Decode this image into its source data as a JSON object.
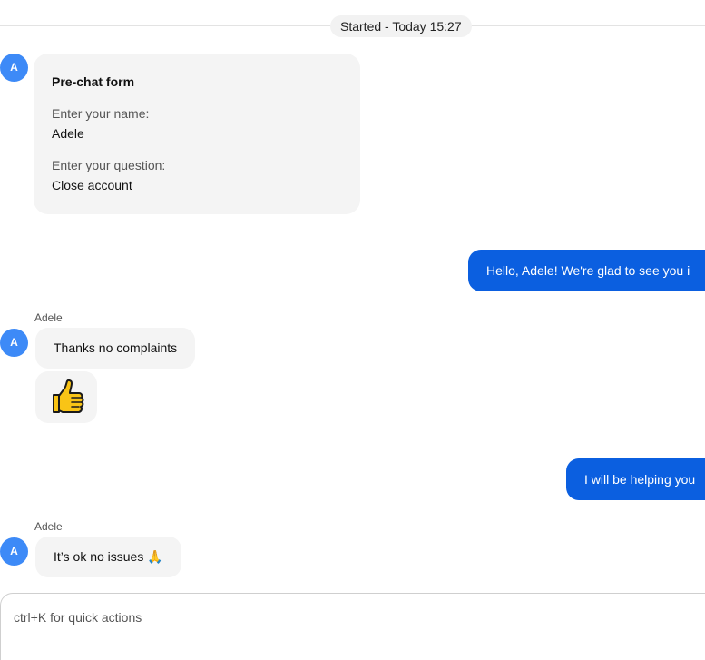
{
  "session": {
    "started_label": "Started - Today 15:27"
  },
  "avatar_initial": "A",
  "prechat_form": {
    "title": "Pre-chat form",
    "fields": [
      {
        "label": "Enter your name:",
        "value": "Adele"
      },
      {
        "label": "Enter your question:",
        "value": "Close account"
      }
    ]
  },
  "messages": [
    {
      "direction": "outgoing",
      "text": "Hello, Adele! We're glad to see you i"
    },
    {
      "direction": "incoming",
      "sender": "Adele",
      "text": "Thanks no complaints"
    },
    {
      "direction": "incoming",
      "sender": "Adele",
      "emoji": "thumbs-up"
    },
    {
      "direction": "outgoing",
      "text": "I will be helping you"
    },
    {
      "direction": "incoming",
      "sender": "Adele",
      "text": "It’s ok no issues 🙏"
    }
  ],
  "composer": {
    "placeholder": "ctrl+K for quick actions"
  },
  "colors": {
    "avatar": "#3d8af7",
    "outgoing_bubble": "#0b5fe0",
    "incoming_bubble": "#f4f4f4",
    "thumb_fill": "#f9c416"
  }
}
